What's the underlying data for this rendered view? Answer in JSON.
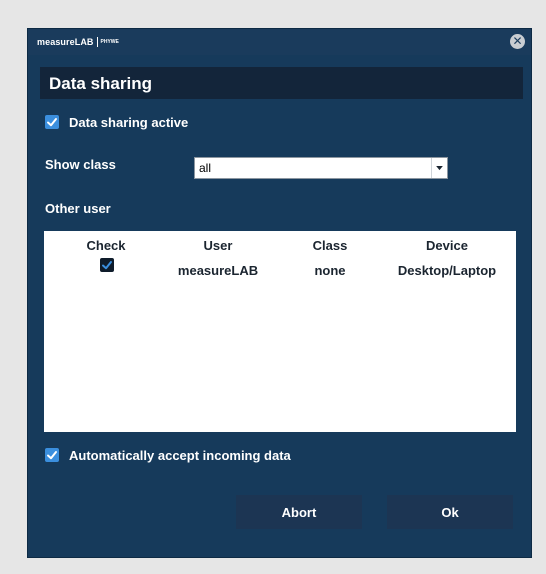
{
  "titlebar": {
    "logo_text": "measureLAB",
    "logo_sub": "PHYWE",
    "close_glyph": "✕"
  },
  "header": {
    "title": "Data sharing"
  },
  "data_sharing_active": {
    "label": "Data sharing active",
    "checked": true
  },
  "show_class": {
    "label": "Show class",
    "selected": "all"
  },
  "other_user": {
    "label": "Other user"
  },
  "table": {
    "columns": [
      "Check",
      "User",
      "Class",
      "Device"
    ],
    "rows": [
      {
        "checked": true,
        "user": "measureLAB",
        "class": "none",
        "device": "Desktop/Laptop"
      }
    ]
  },
  "auto_accept": {
    "label": "Automatically accept incoming data",
    "checked": true
  },
  "buttons": {
    "abort": "Abort",
    "ok": "Ok"
  },
  "colors": {
    "dialog_bg": "#163a5b",
    "header_bg": "#13253a",
    "checkbox_blue": "#3b8fde",
    "button_bg": "#1c3553"
  }
}
